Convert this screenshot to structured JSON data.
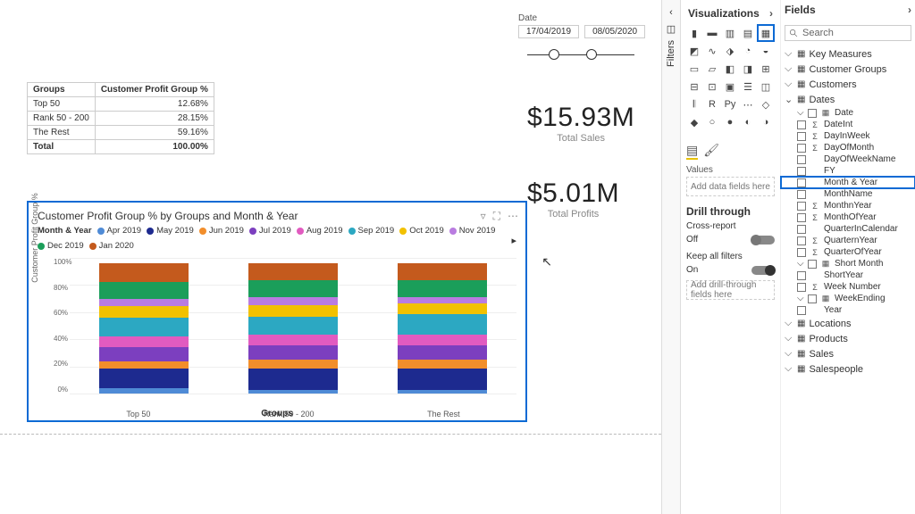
{
  "panes": {
    "viz": "Visualizations",
    "fields": "Fields",
    "filters": "Filters"
  },
  "search_placeholder": "Search",
  "values_label": "Values",
  "values_well": "Add data fields here",
  "drill": {
    "title": "Drill through",
    "cross_label": "Cross-report",
    "cross_state": "Off",
    "keep_label": "Keep all filters",
    "keep_state": "On",
    "well": "Add drill-through fields here"
  },
  "field_tables": [
    {
      "name": "Key Measures",
      "expanded": false,
      "icon": "measure"
    },
    {
      "name": "Customer Groups",
      "expanded": false,
      "icon": "table"
    },
    {
      "name": "Customers",
      "expanded": false,
      "icon": "table"
    },
    {
      "name": "Dates",
      "expanded": true,
      "icon": "table",
      "children": [
        {
          "name": "Date",
          "type": "hier",
          "expanded": false
        },
        {
          "name": "DateInt",
          "type": "sigma"
        },
        {
          "name": "DayInWeek",
          "type": "sigma"
        },
        {
          "name": "DayOfMonth",
          "type": "sigma"
        },
        {
          "name": "DayOfWeekName",
          "type": "text"
        },
        {
          "name": "FY",
          "type": "text"
        },
        {
          "name": "Month & Year",
          "type": "text",
          "highlight": true
        },
        {
          "name": "MonthName",
          "type": "text"
        },
        {
          "name": "MonthnYear",
          "type": "sigma"
        },
        {
          "name": "MonthOfYear",
          "type": "sigma"
        },
        {
          "name": "QuarterInCalendar",
          "type": "text"
        },
        {
          "name": "QuarternYear",
          "type": "sigma"
        },
        {
          "name": "QuarterOfYear",
          "type": "sigma"
        },
        {
          "name": "Short Month",
          "type": "hier"
        },
        {
          "name": "ShortYear",
          "type": "text"
        },
        {
          "name": "Week Number",
          "type": "sigma"
        },
        {
          "name": "WeekEnding",
          "type": "hier",
          "expanded": false
        },
        {
          "name": "Year",
          "type": "text"
        }
      ]
    },
    {
      "name": "Locations",
      "expanded": false,
      "icon": "table"
    },
    {
      "name": "Products",
      "expanded": false,
      "icon": "table"
    },
    {
      "name": "Sales",
      "expanded": false,
      "icon": "table"
    },
    {
      "name": "Salespeople",
      "expanded": false,
      "icon": "table"
    }
  ],
  "slicer": {
    "label": "Date",
    "from": "17/04/2019",
    "to": "08/05/2020"
  },
  "matrix": {
    "col1": "Groups",
    "col2": "Customer Profit Group %",
    "rows": [
      {
        "g": "Top 50",
        "v": "12.68%"
      },
      {
        "g": "Rank 50 - 200",
        "v": "28.15%"
      },
      {
        "g": "The Rest",
        "v": "59.16%"
      }
    ],
    "total_label": "Total",
    "total_value": "100.00%"
  },
  "cards": {
    "sales_value": "$15.93M",
    "sales_label": "Total Sales",
    "profit_value": "$5.01M",
    "profit_label": "Total Profits"
  },
  "chart_data": {
    "type": "bar",
    "stacked_100": true,
    "title": "Customer Profit Group % by Groups and Month & Year",
    "legend_title": "Month & Year",
    "xlabel": "Groups",
    "ylabel": "Customer Profit Group %",
    "ylim": [
      0,
      100
    ],
    "yticks": [
      0,
      20,
      40,
      60,
      80,
      100
    ],
    "categories": [
      "Top 50",
      "Rank 50 - 200",
      "The Rest"
    ],
    "series": [
      {
        "name": "Apr 2019",
        "color": "#4f8bd6",
        "values": [
          4,
          3,
          3
        ]
      },
      {
        "name": "May 2019",
        "color": "#1d2a8f",
        "values": [
          15,
          16,
          16
        ]
      },
      {
        "name": "Jun 2019",
        "color": "#f28e2b",
        "values": [
          6,
          7,
          7
        ]
      },
      {
        "name": "Jul 2019",
        "color": "#7c3fbf",
        "values": [
          11,
          11,
          11
        ]
      },
      {
        "name": "Aug 2019",
        "color": "#e15bc0",
        "values": [
          8,
          8,
          8
        ]
      },
      {
        "name": "Sep 2019",
        "color": "#2ca8c2",
        "values": [
          14,
          14,
          16
        ]
      },
      {
        "name": "Oct 2019",
        "color": "#f2c100",
        "values": [
          9,
          9,
          8
        ]
      },
      {
        "name": "Nov 2019",
        "color": "#b97ce0",
        "values": [
          6,
          6,
          5
        ]
      },
      {
        "name": "Dec 2019",
        "color": "#1b9e5a",
        "values": [
          13,
          13,
          13
        ]
      },
      {
        "name": "Jan 2020",
        "color": "#c45a1d",
        "values": [
          14,
          13,
          13
        ]
      }
    ]
  }
}
